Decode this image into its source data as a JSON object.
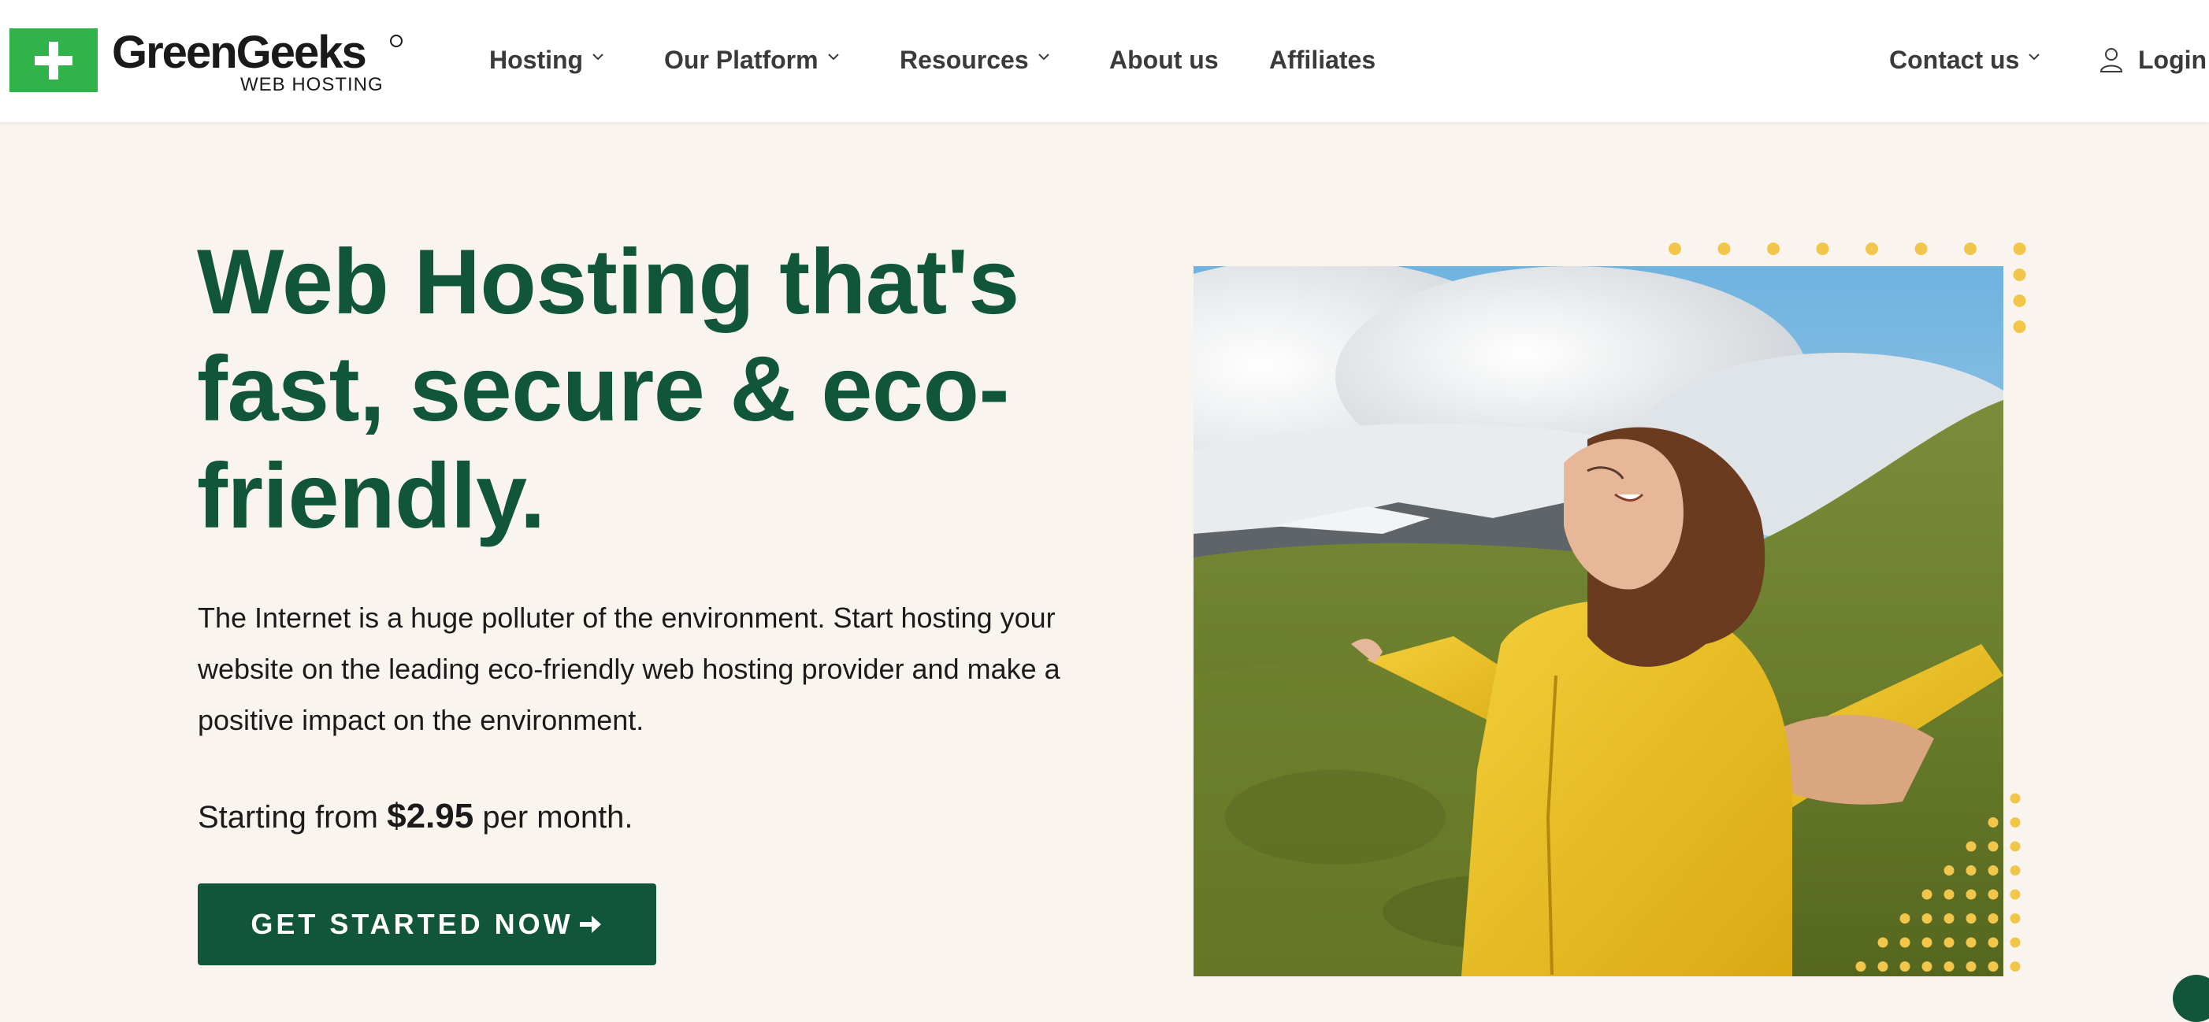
{
  "brand": {
    "name": "GreenGeeks",
    "tagline": "WEB HOSTING",
    "green": "#2fb34a",
    "dark_green": "#11553a",
    "dot_yellow": "#f2c64a"
  },
  "nav": {
    "hosting": "Hosting",
    "platform": "Our Platform",
    "resources": "Resources",
    "about": "About us",
    "affiliates": "Affiliates",
    "contact": "Contact us",
    "login": "Login"
  },
  "hero": {
    "title": "Web Hosting that's fast, secure & eco-friendly.",
    "body": "The Internet is a huge polluter of the environment. Start hosting your website on the leading eco-friendly web hosting provider and make a positive impact on the environment.",
    "price_prefix": "Starting from",
    "price": "$2.95",
    "price_suffix": "per month.",
    "cta": "GET STARTED NOW",
    "cta_icon": "arrow-right-icon"
  },
  "icons": {
    "chevron": "chevron-down-icon",
    "user": "user-icon"
  }
}
